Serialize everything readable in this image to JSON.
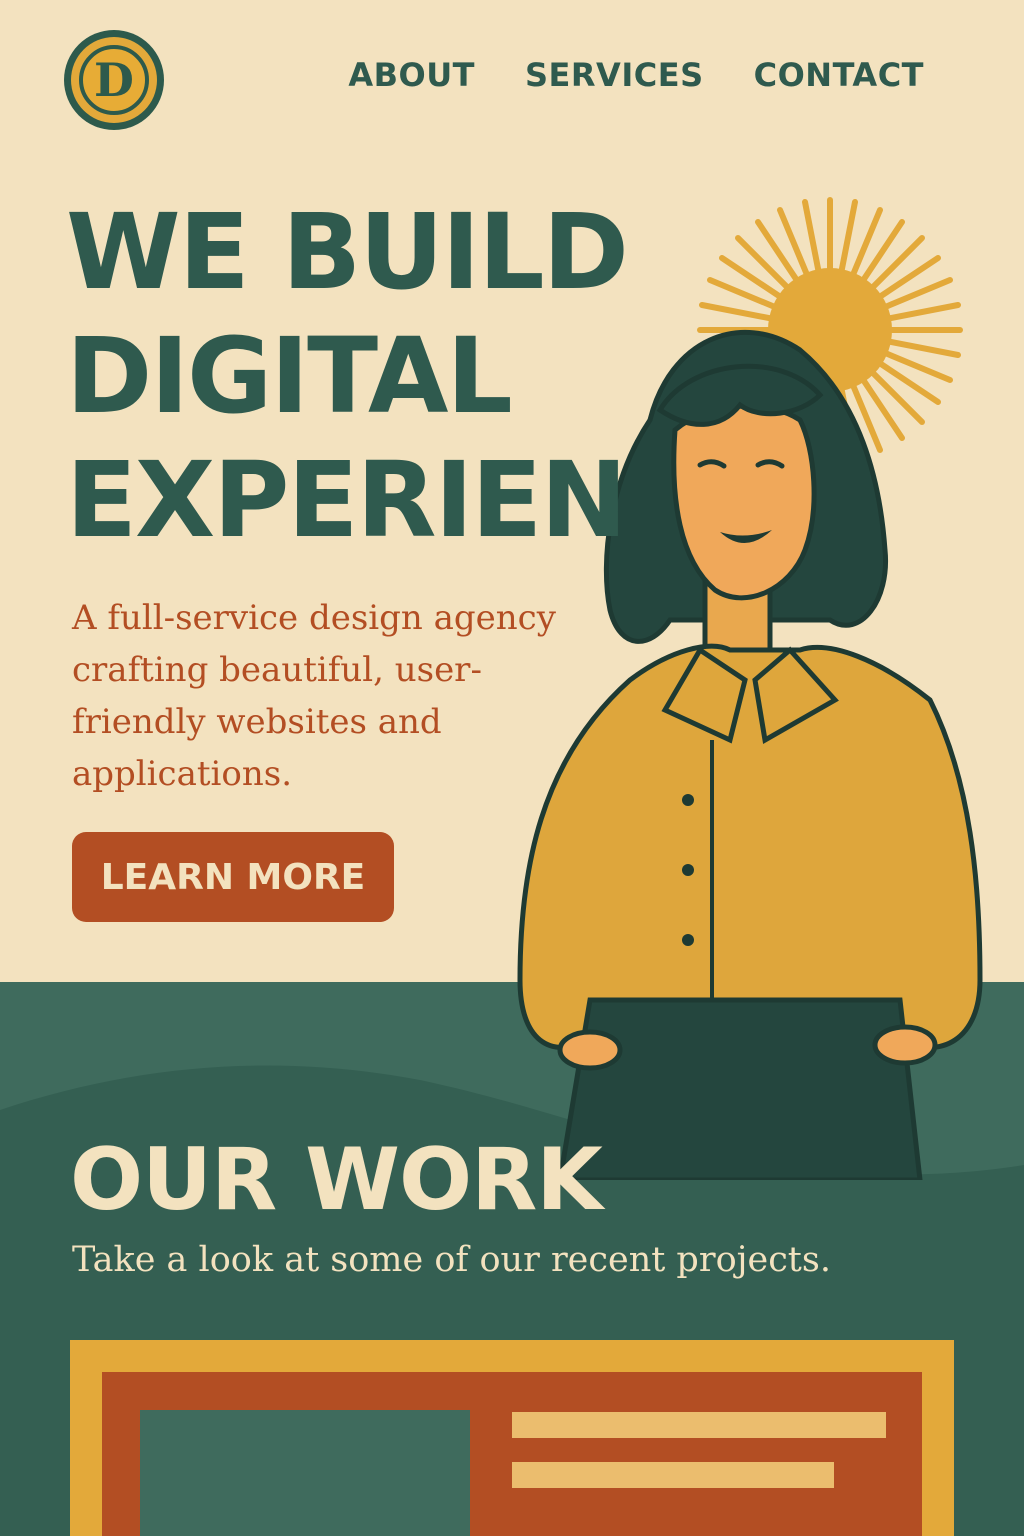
{
  "brand": {
    "logo_letter": "D",
    "logo_icon": "letter-d-badge-icon"
  },
  "nav": {
    "items": [
      {
        "label": "ABOUT"
      },
      {
        "label": "SERVICES"
      },
      {
        "label": "CONTACT"
      }
    ]
  },
  "hero": {
    "headline_lines": [
      "WE BUILD",
      "DIGITAL",
      "EXPERIEN"
    ],
    "subtext": "A full-service design agency crafting beautiful, user-friendly websites and applications.",
    "cta_label": "LEARN MORE",
    "illustration": "woman-with-sun-illustration"
  },
  "work": {
    "title": "OUR WORK",
    "subtitle": "Take a look at some of our recent projects."
  },
  "colors": {
    "cream": "#f3e2bf",
    "green": "#2f5a4e",
    "green_bg": "#3f6b5d",
    "rust": "#b34e23",
    "mustard": "#e3a93a"
  }
}
